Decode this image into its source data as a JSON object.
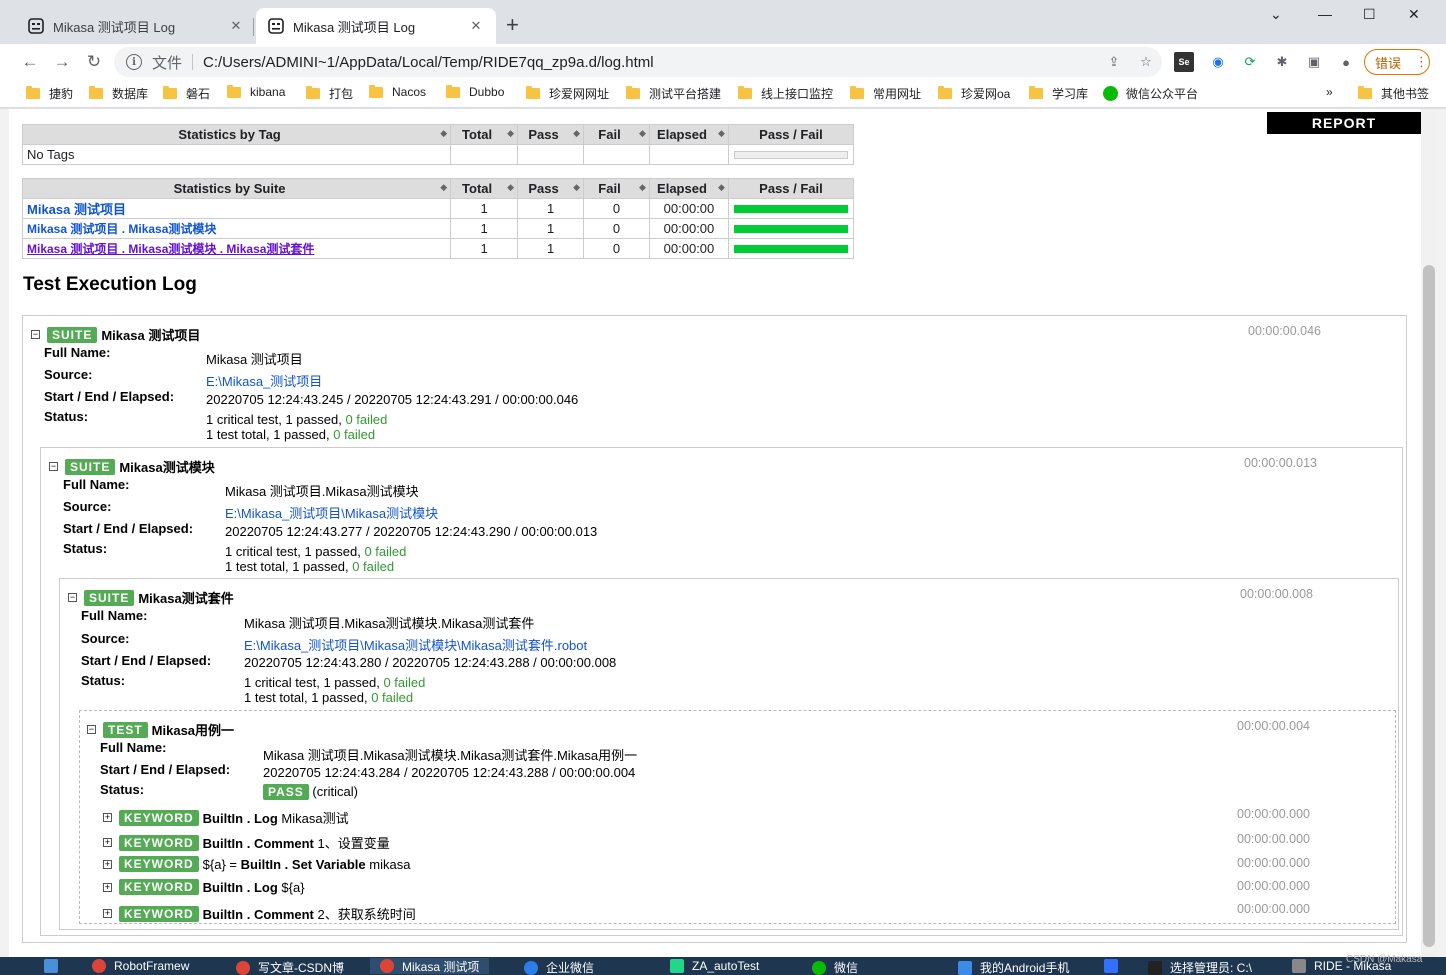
{
  "browser": {
    "tabs": [
      {
        "title": "Mikasa 测试项目 Log",
        "active": false
      },
      {
        "title": "Mikasa 测试项目 Log",
        "active": true
      }
    ],
    "url_prefix": "文件",
    "url": "C:/Users/ADMINI~1/AppData/Local/Temp/RIDE7qq_zp9a.d/log.html",
    "error_button": "错误",
    "bookmarks": [
      "捷豹",
      "数据库",
      "磐石",
      "kibana",
      "打包",
      "Nacos",
      "Dubbo",
      "珍爱网网址",
      "测试平台搭建",
      "线上接口监控",
      "常用网址",
      "珍爱网oa",
      "学习库",
      "微信公众平台"
    ],
    "other_bookmarks": "其他书签",
    "more": "»"
  },
  "report_button": "REPORT",
  "tag_stats": {
    "headers": [
      "Statistics by Tag",
      "Total",
      "Pass",
      "Fail",
      "Elapsed",
      "Pass / Fail"
    ],
    "rows": [
      {
        "name": "No Tags",
        "total": "",
        "pass": "",
        "fail": "",
        "elapsed": "",
        "ratio": 0
      }
    ]
  },
  "suite_stats": {
    "headers": [
      "Statistics by Suite",
      "Total",
      "Pass",
      "Fail",
      "Elapsed",
      "Pass / Fail"
    ],
    "rows": [
      {
        "name": "Mikasa 测试项目",
        "total": "1",
        "pass": "1",
        "fail": "0",
        "elapsed": "00:00:00",
        "ratio": 1
      },
      {
        "name": "Mikasa 测试项目 . Mikasa测试模块",
        "total": "1",
        "pass": "1",
        "fail": "0",
        "elapsed": "00:00:00",
        "ratio": 1
      },
      {
        "name": "Mikasa 测试项目 . Mikasa测试模块 . Mikasa测试套件",
        "total": "1",
        "pass": "1",
        "fail": "0",
        "elapsed": "00:00:00",
        "ratio": 1
      }
    ]
  },
  "exec_log_title": "Test Execution Log",
  "labels": {
    "suite": "SUITE",
    "test": "TEST",
    "keyword": "KEYWORD",
    "pass": "PASS",
    "full_name": "Full Name:",
    "source": "Source:",
    "start_end": "Start / End / Elapsed:",
    "status": "Status:",
    "critical": "(critical)"
  },
  "suite1": {
    "name": "Mikasa 测试项目",
    "elapsed": "00:00:00.046",
    "full_name": "Mikasa 测试项目",
    "source": "E:\\Mikasa_测试项目",
    "times": "20220705 12:24:43.245 / 20220705 12:24:43.291 / 00:00:00.046",
    "status1": "1 critical test, 1 passed,",
    "status1_failed": "0 failed",
    "status2": "1 test total, 1 passed,",
    "status2_failed": "0 failed"
  },
  "suite2": {
    "name": "Mikasa测试模块",
    "elapsed": "00:00:00.013",
    "full_name": "Mikasa 测试项目.Mikasa测试模块",
    "source": "E:\\Mikasa_测试项目\\Mikasa测试模块",
    "times": "20220705 12:24:43.277 / 20220705 12:24:43.290 / 00:00:00.013",
    "status1": "1 critical test, 1 passed,",
    "status1_failed": "0 failed",
    "status2": "1 test total, 1 passed,",
    "status2_failed": "0 failed"
  },
  "suite3": {
    "name": "Mikasa测试套件",
    "elapsed": "00:00:00.008",
    "full_name": "Mikasa 测试项目.Mikasa测试模块.Mikasa测试套件",
    "source": "E:\\Mikasa_测试项目\\Mikasa测试模块\\Mikasa测试套件.robot",
    "times": "20220705 12:24:43.280 / 20220705 12:24:43.288 / 00:00:00.008",
    "status1": "1 critical test, 1 passed,",
    "status1_failed": "0 failed",
    "status2": "1 test total, 1 passed,",
    "status2_failed": "0 failed"
  },
  "test": {
    "name": "Mikasa用例一",
    "elapsed": "00:00:00.004",
    "full_name": "Mikasa 测试项目.Mikasa测试模块.Mikasa测试套件.Mikasa用例一",
    "times": "20220705 12:24:43.284 / 20220705 12:24:43.288 / 00:00:00.004"
  },
  "keywords": [
    {
      "pre": "",
      "name": "BuiltIn . Log",
      "args": "Mikasa测试",
      "elapsed": "00:00:00.000"
    },
    {
      "pre": "",
      "name": "BuiltIn . Comment",
      "args": "1、设置变量",
      "elapsed": "00:00:00.000"
    },
    {
      "pre": "${a} = ",
      "name": "BuiltIn . Set Variable",
      "args": "mikasa",
      "elapsed": "00:00:00.000"
    },
    {
      "pre": "",
      "name": "BuiltIn . Log",
      "args": "${a}",
      "elapsed": "00:00:00.000"
    },
    {
      "pre": "",
      "name": "BuiltIn . Comment",
      "args": "2、获取系统时间",
      "elapsed": "00:00:00.000"
    }
  ],
  "taskbar": [
    "RobotFramew",
    "写文章-CSDN博",
    "Mikasa 测试项",
    "企业微信",
    "ZA_autoTest",
    "微信",
    "我的Android手机",
    "选择管理员: C:\\",
    "RIDE - Mikasa"
  ],
  "watermark": "CSDN @Makasa",
  "colors": {
    "pass_green": "#00cc33",
    "label_green": "#55aa55",
    "link_blue": "#1155cc"
  }
}
